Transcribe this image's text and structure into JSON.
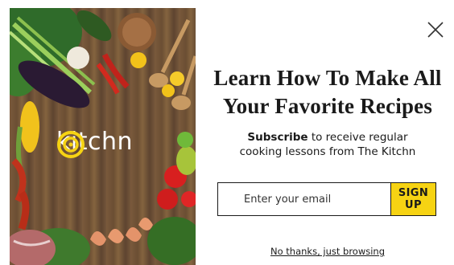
{
  "modal": {
    "brand": {
      "name": "kitchn",
      "logo_icon": "kitchn-logo-icon"
    },
    "close_icon": "close-icon",
    "headline": {
      "line1": "Learn How To Make All",
      "line2": "Your Favorite Recipes"
    },
    "subtext": {
      "bold": "Subscribe",
      "line1_rest": " to receive regular",
      "line2": "cooking lessons from The Kitchn"
    },
    "form": {
      "email_placeholder": "Enter your email",
      "submit_label": "SIGN UP"
    },
    "dismiss_label": "No thanks, just browsing",
    "colors": {
      "accent": "#f6d313",
      "text": "#1a1a1a",
      "brand_logo": "#f6d313"
    }
  }
}
